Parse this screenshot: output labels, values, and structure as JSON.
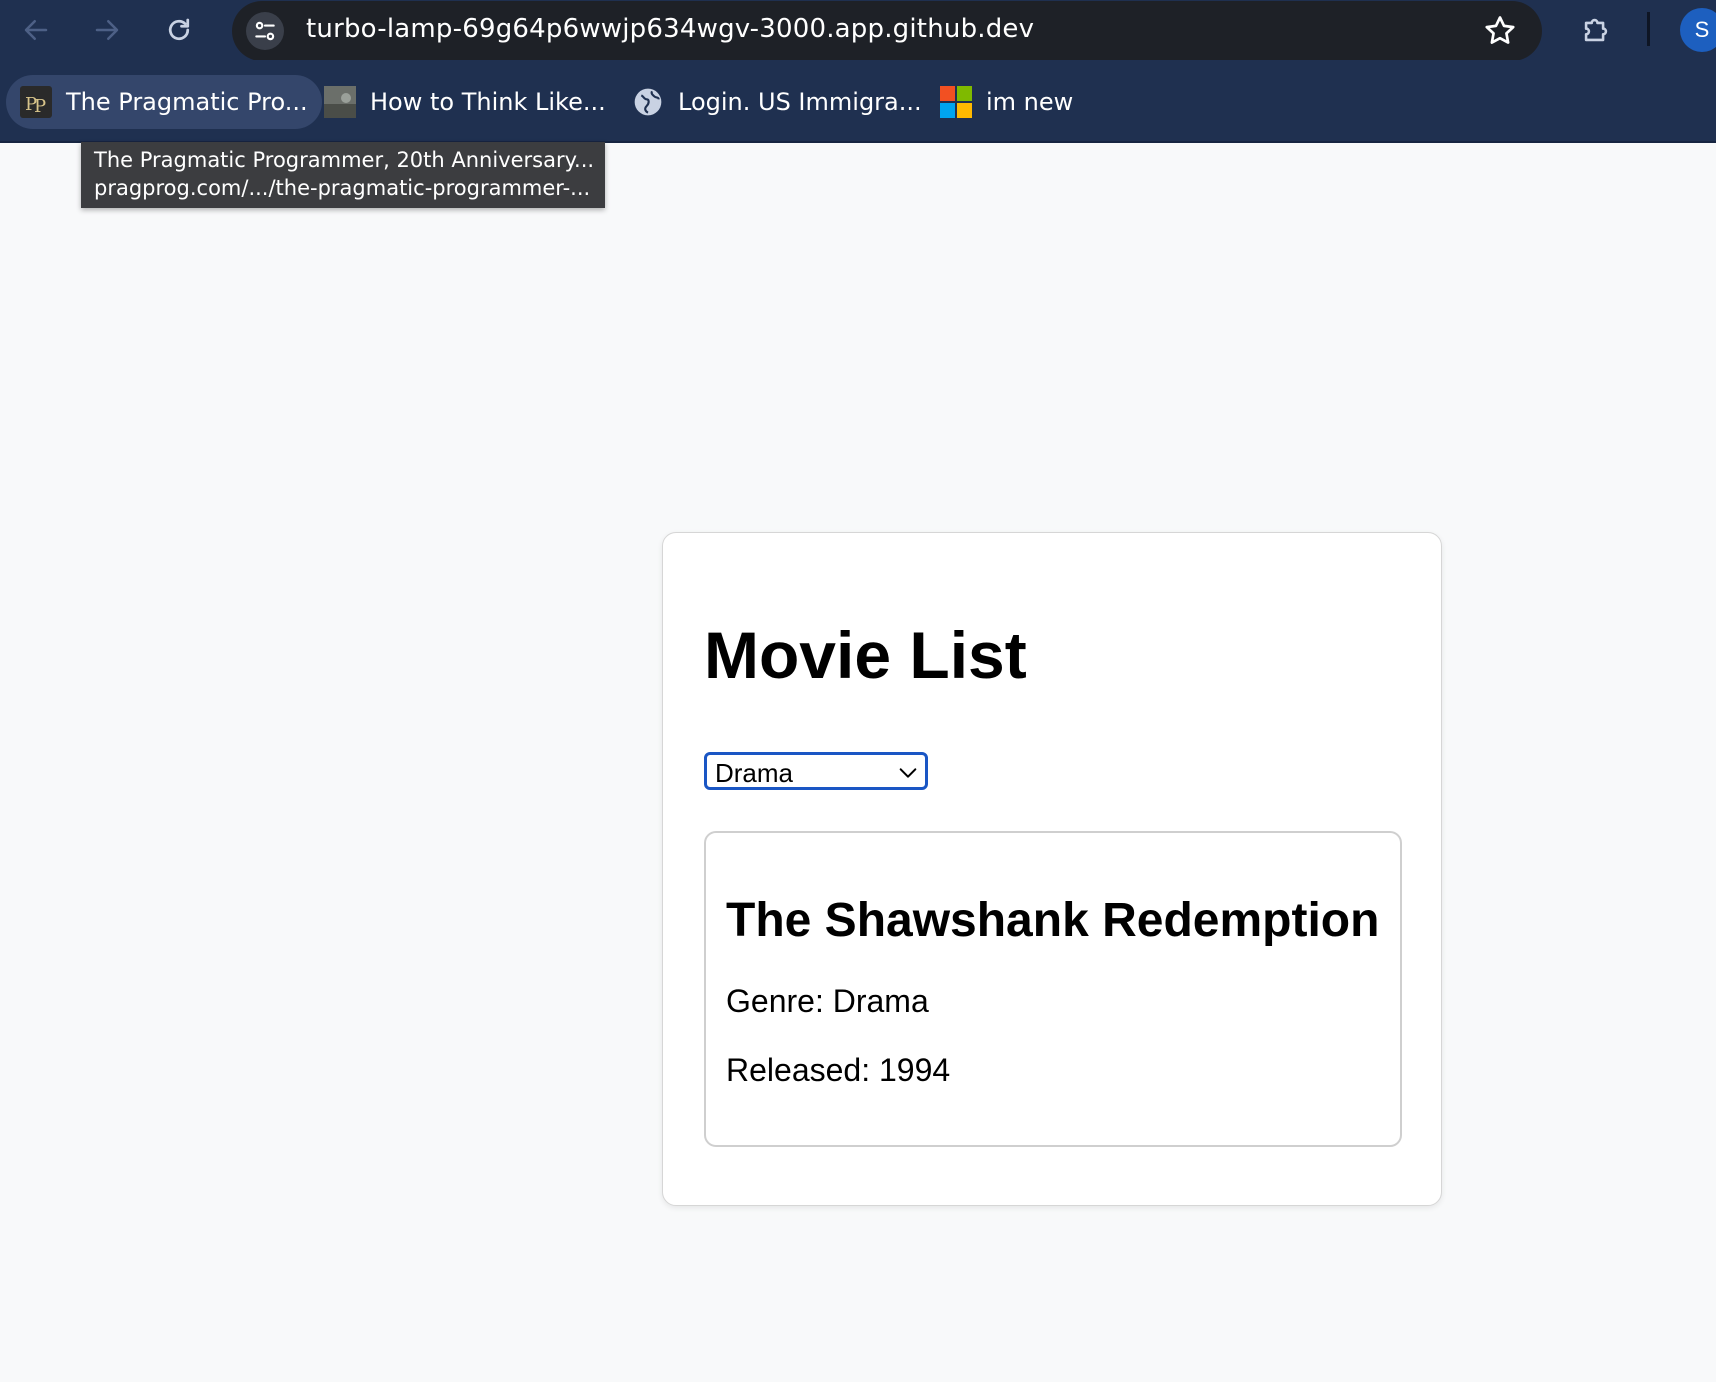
{
  "browser": {
    "url": "turbo-lamp-69g64p6wwjp634wgv-3000.app.github.dev",
    "avatar_letter": "S"
  },
  "bookmarks": [
    {
      "label": "The Pragmatic Pro...",
      "icon": "pragprog-logo-icon"
    },
    {
      "label": "How to Think Like...",
      "icon": "thumbnail-image-icon"
    },
    {
      "label": "Login. US Immigra...",
      "icon": "globe-icon"
    },
    {
      "label": "im new",
      "icon": "microsoft-logo-icon"
    }
  ],
  "tooltip": {
    "line1": "The Pragmatic Programmer, 20th Anniversary...",
    "line2": "pragprog.com/.../the-pragmatic-programmer-..."
  },
  "page": {
    "title": "Movie List",
    "genre_select": {
      "selected": "Drama"
    },
    "movies": [
      {
        "title": "The Shawshank Redemption",
        "genre": "Genre: Drama",
        "released": "Released: 1994"
      }
    ]
  },
  "colors": {
    "chrome": "#1f3050",
    "omnibox": "#1e2127",
    "page_bg": "#f8f9fa",
    "select_focus": "#1a56c4"
  }
}
